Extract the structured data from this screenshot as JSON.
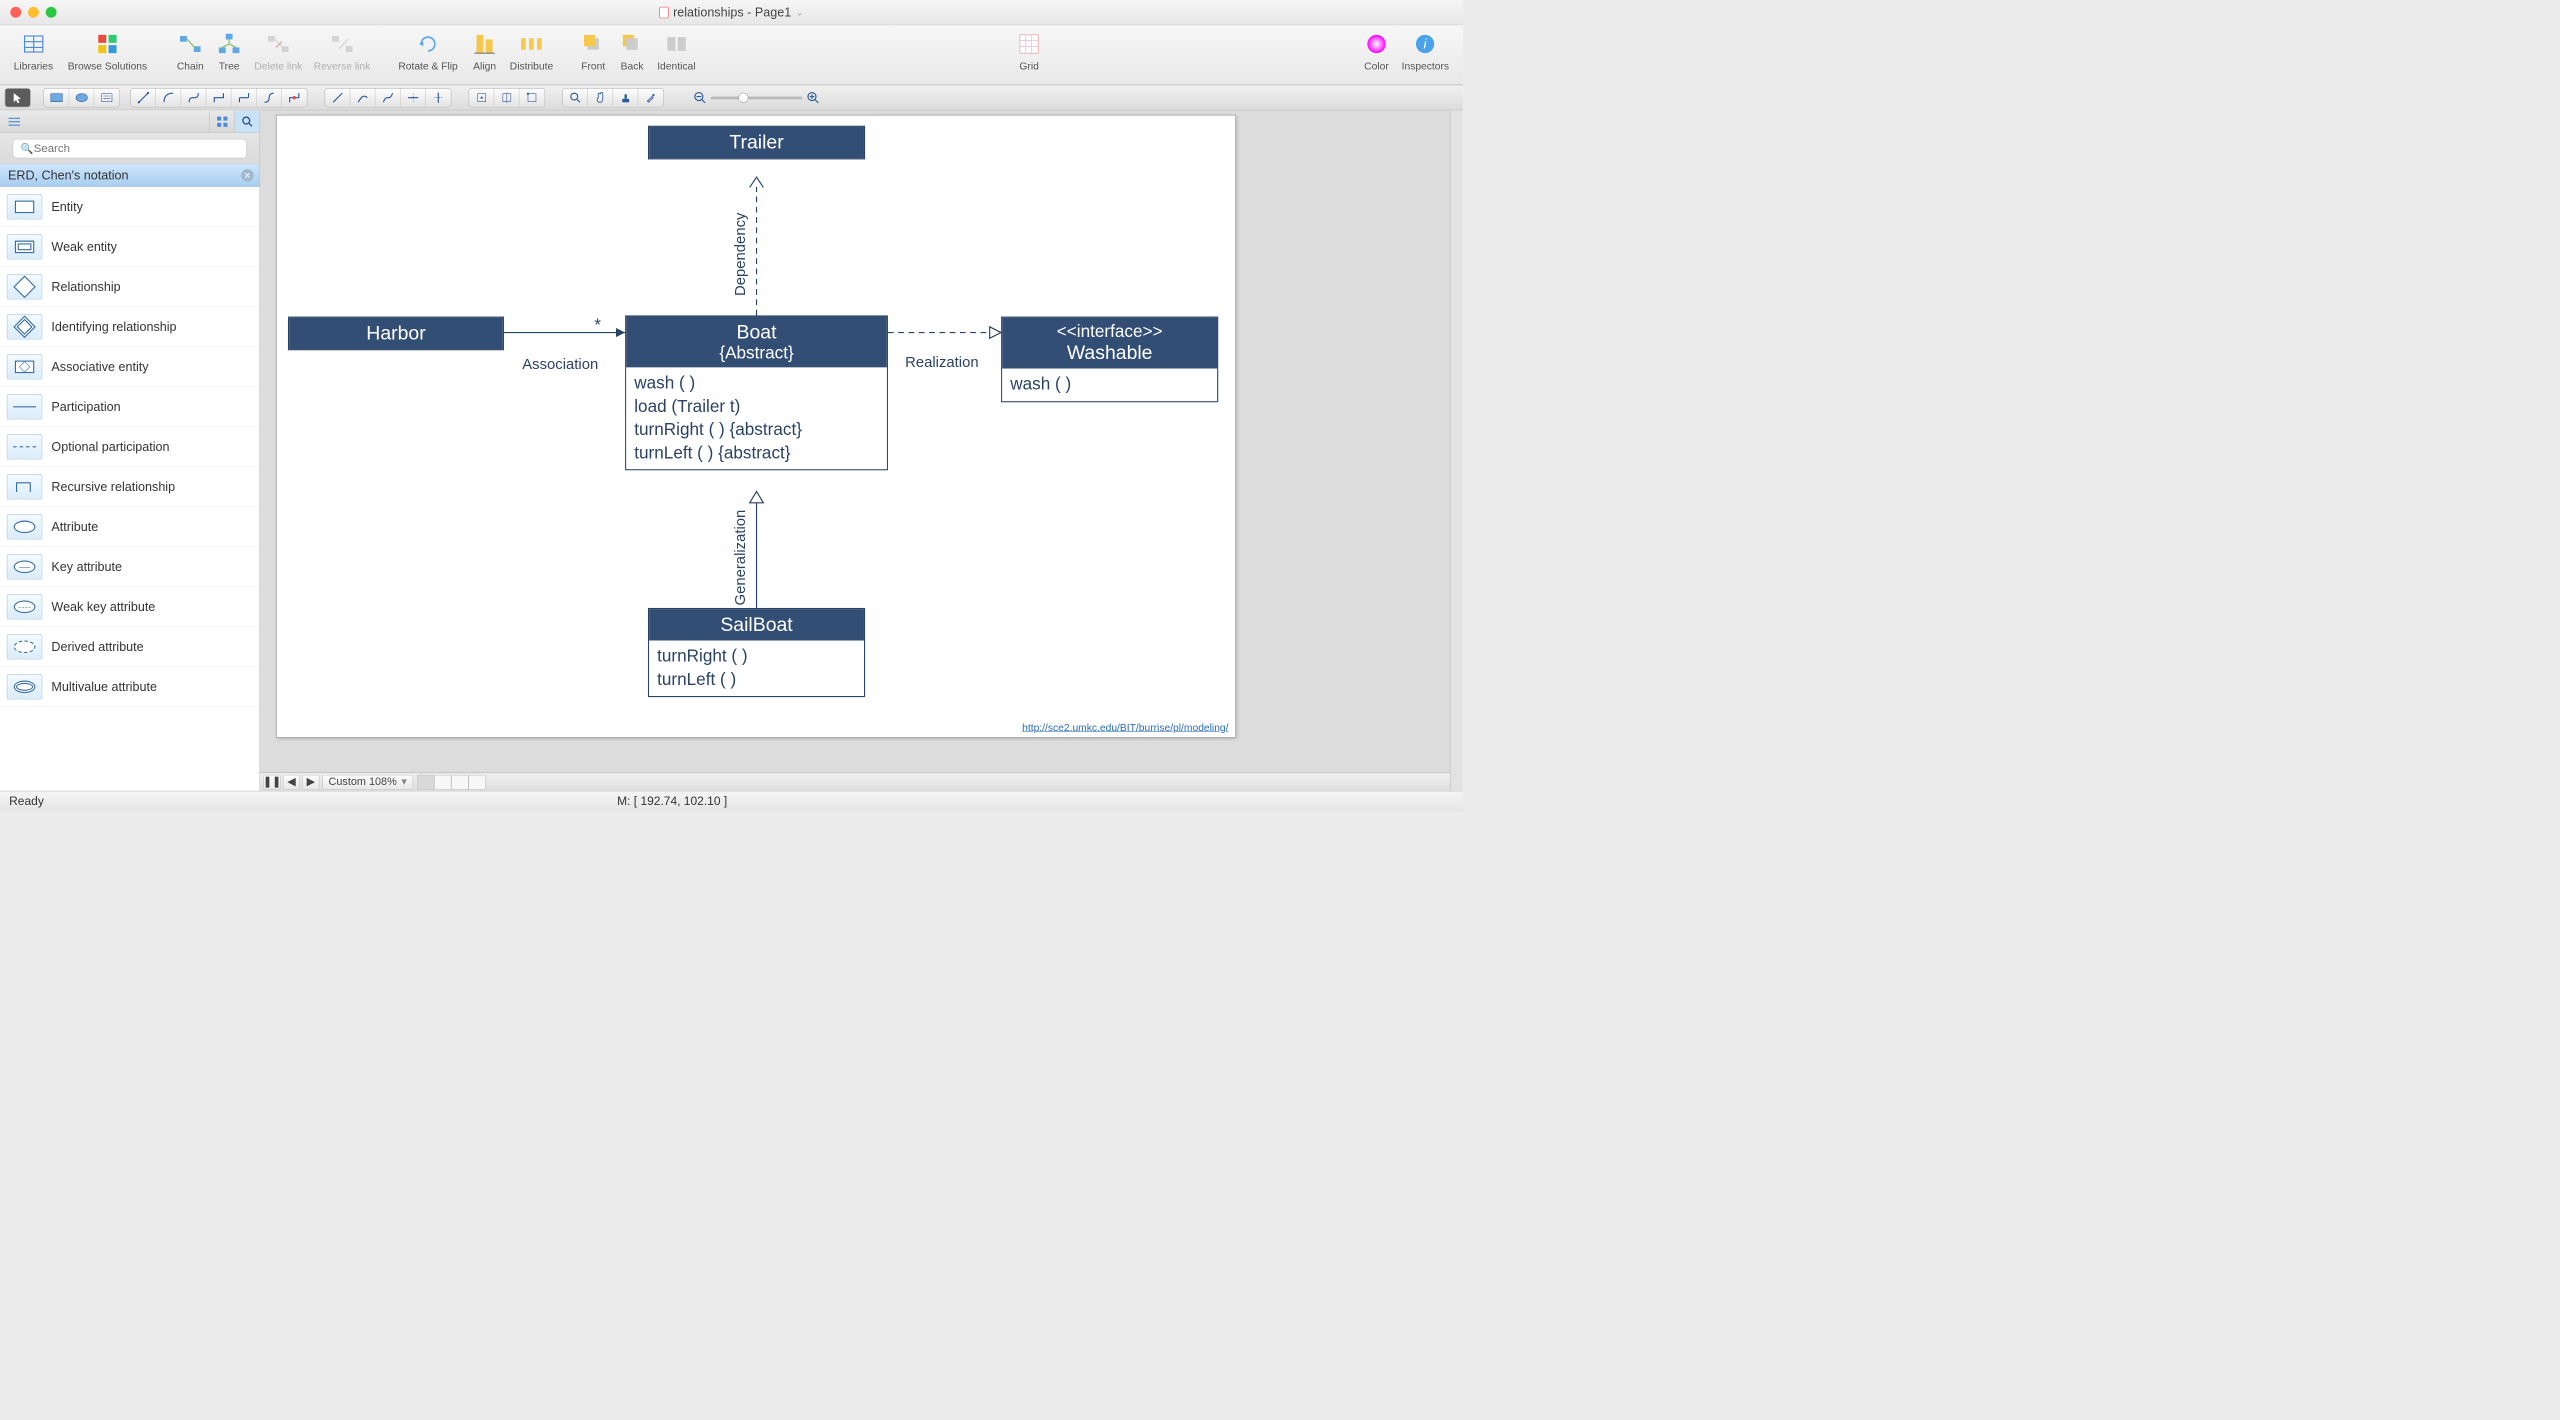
{
  "window": {
    "title": "relationships - Page1"
  },
  "toolbar": {
    "libraries": "Libraries",
    "browse": "Browse Solutions",
    "chain": "Chain",
    "tree": "Tree",
    "delete_link": "Delete link",
    "reverse_link": "Reverse link",
    "rotate_flip": "Rotate & Flip",
    "align": "Align",
    "distribute": "Distribute",
    "front": "Front",
    "back": "Back",
    "identical": "Identical",
    "grid": "Grid",
    "color": "Color",
    "inspectors": "Inspectors"
  },
  "sidebar": {
    "search_placeholder": "Search",
    "section": "ERD, Chen's notation",
    "items": [
      {
        "label": "Entity"
      },
      {
        "label": "Weak entity"
      },
      {
        "label": "Relationship"
      },
      {
        "label": "Identifying relationship"
      },
      {
        "label": "Associative entity"
      },
      {
        "label": "Participation"
      },
      {
        "label": "Optional participation"
      },
      {
        "label": "Recursive relationship"
      },
      {
        "label": "Attribute"
      },
      {
        "label": "Key attribute"
      },
      {
        "label": "Weak key attribute"
      },
      {
        "label": "Derived attribute"
      },
      {
        "label": "Multivalue attribute"
      }
    ]
  },
  "diagram": {
    "trailer": "Trailer",
    "harbor": "Harbor",
    "boat_title": "Boat",
    "boat_sub": "{Abstract}",
    "boat_ops": [
      "wash ( )",
      "load (Trailer t)",
      "turnRight ( ) {abstract}",
      "turnLeft ( ) {abstract}"
    ],
    "washable_stereo": "<<interface>>",
    "washable_name": "Washable",
    "washable_ops": [
      "wash ( )"
    ],
    "sailboat_title": "SailBoat",
    "sailboat_ops": [
      "turnRight ( )",
      "turnLeft ( )"
    ],
    "association": "Association",
    "star": "*",
    "dependency": "Dependency",
    "realization": "Realization",
    "generalization": "Generalization",
    "footer_link": "http://sce2.umkc.edu/BIT/burrise/pl/modeling/"
  },
  "pagebar": {
    "zoom": "Custom 108%"
  },
  "status": {
    "ready": "Ready",
    "mouse": "M: [ 192.74, 102.10 ]"
  }
}
